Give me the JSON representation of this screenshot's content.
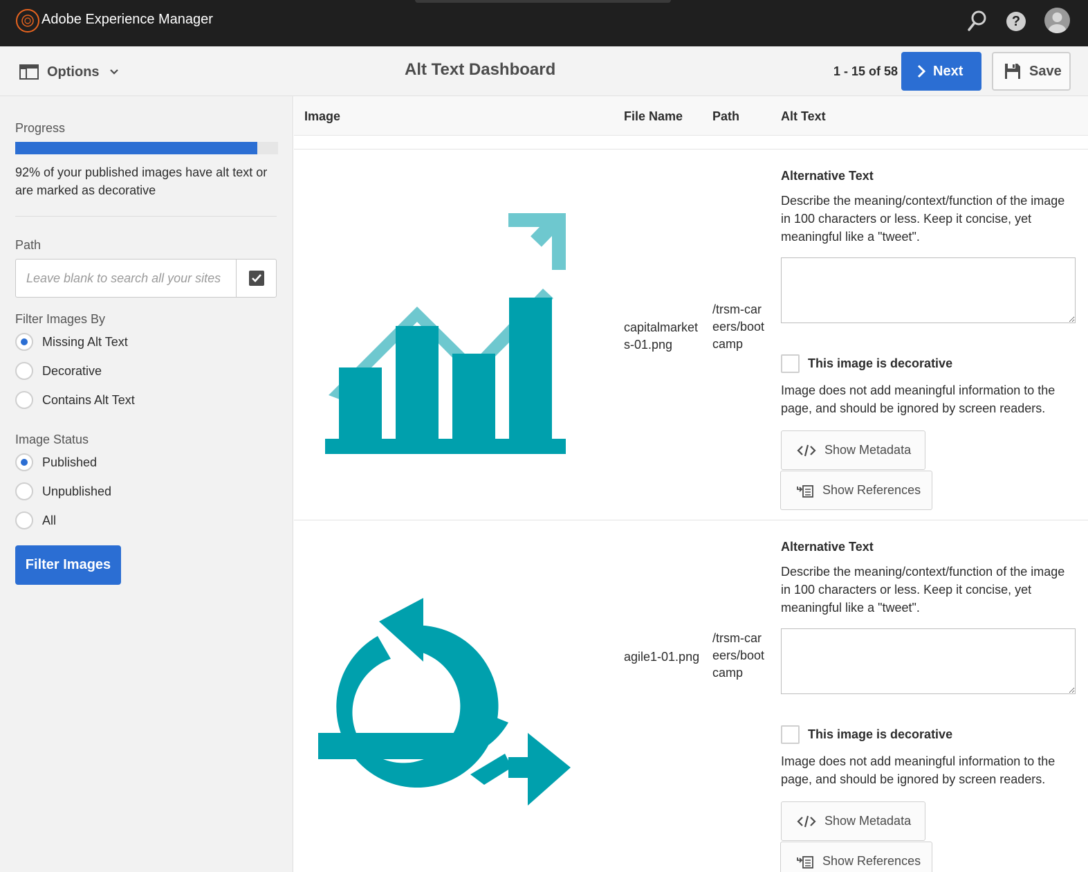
{
  "topbar": {
    "app_title": "Adobe Experience Manager",
    "icons": [
      "adobe-logo-icon",
      "search-icon",
      "help-icon",
      "user-avatar-icon"
    ]
  },
  "actionbar": {
    "options_label": "Options",
    "page_title": "Alt Text Dashboard",
    "pager": "1 - 15 of 58",
    "next_label": "Next",
    "save_label": "Save"
  },
  "sidebar": {
    "progress_label": "Progress",
    "progress_fraction": 0.92,
    "progress_text": "92% of your published images have alt text or are marked as decorative",
    "path_label": "Path",
    "path_placeholder": "Leave blank to search all your sites",
    "path_value": "",
    "filter_label": "Filter Images By",
    "filter_options": [
      {
        "label": "Missing Alt Text",
        "checked": true
      },
      {
        "label": "Decorative",
        "checked": false
      },
      {
        "label": "Contains Alt Text",
        "checked": false
      }
    ],
    "status_label": "Image Status",
    "status_options": [
      {
        "label": "Published",
        "checked": true
      },
      {
        "label": "Unpublished",
        "checked": false
      },
      {
        "label": "All",
        "checked": false
      }
    ],
    "filter_button": "Filter Images"
  },
  "table": {
    "headers": [
      "Image",
      "File Name",
      "Path",
      "Alt Text"
    ],
    "rows": [
      {
        "image_icon": "bar-chart-trend-icon",
        "file_name": "capitalmarkets-01.png",
        "path": "/trsm-careers/bootcamp",
        "alt_title": "Alternative Text",
        "alt_desc": "Describe the meaning/context/function of the image in 100 characters or less. Keep it concise, yet meaningful like a \"tweet\".",
        "alt_value": "",
        "decorative_checked": false,
        "decorative_label": "This image is decorative",
        "decorative_desc": "Image does not add meaningful information to the page, and should be ignored by screen readers.",
        "metadata_button": "Show Metadata",
        "references_button": "Show References"
      },
      {
        "image_icon": "agile-cycle-icon",
        "file_name": "agile1-01.png",
        "path": "/trsm-careers/bootcamp",
        "alt_title": "Alternative Text",
        "alt_desc": "Describe the meaning/context/function of the image in 100 characters or less. Keep it concise, yet meaningful like a \"tweet\".",
        "alt_value": "",
        "decorative_checked": false,
        "decorative_label": "This image is decorative",
        "decorative_desc": "Image does not add meaningful information to the page, and should be ignored by screen readers.",
        "metadata_button": "Show Metadata",
        "references_button": "Show References"
      }
    ]
  },
  "colors": {
    "accent": "#2b6ed3",
    "topbar": "#1f1f1f",
    "teal_dark": "#00a0ad",
    "teal_light": "#6ec8cf",
    "logo_orange": "#e8641f"
  }
}
